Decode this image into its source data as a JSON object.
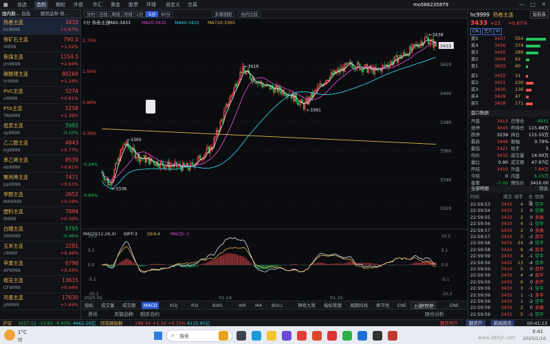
{
  "topbar": {
    "nav": [
      "自选",
      "合约",
      "期权",
      "外盘",
      "外汇",
      "黄金",
      "股票",
      "环球",
      "自定义",
      "交易"
    ],
    "active_index": 1,
    "user": "mo566235879",
    "window_controls": [
      "—",
      "□",
      "✕"
    ]
  },
  "sidebar": {
    "tabs": [
      "国内期...",
      "自选",
      "期货品种",
      "快..."
    ],
    "items": [
      {
        "name": "热卷主连",
        "code": "hc9999",
        "price": "3433",
        "change": "+0.67%",
        "dir": "up"
      },
      {
        "name": "铁矿石主连",
        "code": "i9999",
        "price": "790.0",
        "change": "+1.02%",
        "dir": "up"
      },
      {
        "name": "焦煤主连",
        "code": "jm9999",
        "price": "1154.5",
        "change": "+2.94%",
        "dir": "up"
      },
      {
        "name": "碳酸锂主连",
        "code": "lc9999",
        "price": "80260",
        "change": "+1.24%",
        "dir": "up"
      },
      {
        "name": "PVC主连",
        "code": "v9999",
        "price": "5274",
        "change": "+0.61%",
        "dir": "up"
      },
      {
        "name": "PTA主连",
        "code": "TA9999",
        "price": "5258",
        "change": "+1.39%",
        "dir": "up"
      },
      {
        "name": "纸浆主连",
        "code": "sp9999",
        "price": "5992",
        "change": "-0.10%",
        "dir": "dn"
      },
      {
        "name": "乙二醇主连",
        "code": "eg9999",
        "price": "4843",
        "change": "+0.77%",
        "dir": "up"
      },
      {
        "name": "苯乙烯主连",
        "code": "eb9999",
        "price": "8539",
        "change": "+0.81%",
        "dir": "up"
      },
      {
        "name": "聚丙烯主连",
        "code": "pp9999",
        "price": "7471",
        "change": "+0.51%",
        "dir": "up"
      },
      {
        "name": "甲醇主连",
        "code": "MA9999",
        "price": "2652",
        "change": "+0.19%",
        "dir": "up"
      },
      {
        "name": "塑料主连",
        "code": "l9999",
        "price": "7894",
        "change": "+0.36%",
        "dir": "up"
      },
      {
        "name": "白糖主连",
        "code": "SR9999",
        "price": "5795",
        "change": "-0.46%",
        "dir": "dn"
      },
      {
        "name": "玉米主连",
        "code": "c9999",
        "price": "2281",
        "change": "+0.44%",
        "dir": "up"
      },
      {
        "name": "苹果主连",
        "code": "AP9999",
        "price": "6790",
        "change": "+0.03%",
        "dir": "up"
      },
      {
        "name": "棉花主连",
        "code": "CF9999",
        "price": "13615",
        "change": "+0.44%",
        "dir": "up"
      },
      {
        "name": "鸡蛋主连",
        "code": "jd9999",
        "price": "17630",
        "change": "+1.84%",
        "dir": "up"
      },
      {
        "name": "",
        "code": "ru9999",
        "price": "",
        "change": "",
        "dir": "up"
      }
    ]
  },
  "toolbar": {
    "periods": [
      "分时",
      "日线",
      "周线",
      "月线",
      "1分",
      "5分",
      "60分"
    ],
    "active_period": "5分",
    "extra": [
      "多周期图",
      "合约比较"
    ],
    "title": "5分 热卷主连",
    "ma_labels": [
      "MA5:3433",
      "MA20:3432",
      "MA60:3422",
      "MA720:3365"
    ]
  },
  "chart_data": {
    "type": "candlestick",
    "y_range": [
      3310,
      3445
    ],
    "y_ticks_right": [
      "3433",
      "3420",
      "3400",
      "3380",
      "3360",
      "3340",
      "3320"
    ],
    "y_ticks_left": [
      "2.73%",
      "1.55%",
      "0.96%",
      "0.36%",
      "-0.24%",
      "-0.84%"
    ],
    "annotations": [
      {
        "label": "3438",
        "value": 3438
      },
      {
        "label": "3416",
        "value": 3416
      },
      {
        "label": "3391",
        "value": 3391
      },
      {
        "label": "3365",
        "value": 3365
      },
      {
        "label": "3336",
        "value": 3336
      }
    ],
    "x_labels": [
      "2025-01",
      "01-14",
      "01-15"
    ],
    "macd": {
      "title": "MACD(12,26,9)",
      "diff": "DIFF:3",
      "dea": "DEA:4",
      "macd": "MACD:-1",
      "y_ticks": [
        "10.2",
        "5.1",
        "0.0",
        "-5.1",
        "-10.2"
      ]
    },
    "series_colors": {
      "up": "#ff4d4d",
      "down": "#22c55e",
      "ma5": "#e8eaee",
      "ma20": "#e04fd0",
      "ma60": "#34d5e6",
      "ma720": "#e6b84f"
    }
  },
  "bottom_tabs": [
    "指标",
    "成交量",
    "成交额",
    "MACD",
    "KDJ",
    "RSI",
    "BIAS",
    "WR",
    "MA",
    "BOLL",
    "神奇九转",
    "指标管理",
    "周期均线",
    "季节性",
    "ENE",
    "EXPMA",
    "ENE"
  ],
  "bottom_tabs_active": "MACD",
  "bottom_btn": "右键/双击",
  "subtabs": [
    "资讯",
    "关联品种",
    "相关合约"
  ],
  "subtabs_right": "持仓分析",
  "right": {
    "code": "hc9999",
    "name": "热卷主连",
    "add_btn": "加自选",
    "price": "3433",
    "change": "+23",
    "change_pct": "+0.67%",
    "tags": [
      "CN",
      "主力",
      "VI"
    ],
    "asks": [
      {
        "lbl": "卖5",
        "price": "3437",
        "vol": "554",
        "bar": 0.9
      },
      {
        "lbl": "卖4",
        "price": "3436",
        "vol": "374",
        "bar": 0.65
      },
      {
        "lbl": "卖3",
        "price": "3435",
        "vol": "289",
        "bar": 0.55
      },
      {
        "lbl": "卖2",
        "price": "3434",
        "vol": "62",
        "bar": 0.15
      },
      {
        "lbl": "卖1",
        "price": "3433",
        "vol": "40",
        "bar": 0.1
      }
    ],
    "bids": [
      {
        "lbl": "买1",
        "price": "3432",
        "vol": "31",
        "bar": 0.1
      },
      {
        "lbl": "买2",
        "price": "3431",
        "vol": "230",
        "bar": 0.35
      },
      {
        "lbl": "买3",
        "price": "3430",
        "vol": "136",
        "bar": 0.25
      },
      {
        "lbl": "买4",
        "price": "3429",
        "vol": "47",
        "bar": 0.12
      },
      {
        "lbl": "买5",
        "price": "3428",
        "vol": "171",
        "bar": 0.3
      }
    ],
    "section_title": "盘口数据",
    "stats": [
      [
        "开盘",
        "3413",
        "日增仓",
        "-4031"
      ],
      [
        "涨停",
        "3645",
        "昨持仓",
        "115.88万"
      ],
      [
        "跌停",
        "3239",
        "持仓",
        "115.55万"
      ],
      [
        "最高",
        "3448",
        "振幅",
        "0.79%"
      ],
      [
        "最低",
        "3421",
        "现手",
        "5"
      ],
      [
        "均价",
        "3432",
        "成交量",
        "14.00万"
      ],
      [
        "量比",
        "0.90",
        "成交额",
        "47.97亿"
      ],
      [
        "昨结",
        "3410",
        "外盘",
        "7.84万"
      ],
      [
        "今结",
        "0",
        "内盘",
        "6.15万"
      ],
      [
        "基差",
        "-7.00",
        "预估价",
        "3410.00"
      ]
    ],
    "ticks_title": "全部明细",
    "ticks_right": "筛选",
    "ticks_header": [
      "时间",
      "成交",
      "现手",
      "仓差",
      "性质"
    ],
    "ticks": [
      [
        "22:59:53",
        "3433",
        "4",
        "-2",
        "空平",
        "dn"
      ],
      [
        "22:59:54",
        "3433",
        "1",
        "0",
        "空换",
        "dn"
      ],
      [
        "22:59:55",
        "3432",
        "2",
        "0",
        "多换",
        "up"
      ],
      [
        "22:59:56",
        "3433",
        "4",
        "-1",
        "空平",
        "dn"
      ],
      [
        "22:59:57",
        "3433",
        "2",
        "0",
        "多换",
        "up"
      ],
      [
        "22:59:57",
        "3433",
        "2",
        "-2",
        "双平",
        "up"
      ],
      [
        "22:59:58",
        "3433",
        "24",
        "-8",
        "空平",
        "dn"
      ],
      [
        "22:59:58",
        "3433",
        "9",
        "-6",
        "双平",
        "up"
      ],
      [
        "22:59:59",
        "3433",
        "4",
        "-1",
        "空平",
        "dn"
      ],
      [
        "22:59:59",
        "3432",
        "13",
        "-4",
        "空平",
        "dn"
      ],
      [
        "22:59:59",
        "3433",
        "5",
        "0",
        "双开",
        "up"
      ],
      [
        "22:59:59",
        "3433",
        "4",
        "-4",
        "双平",
        "up"
      ],
      [
        "22:59:59",
        "3433",
        "6",
        "0",
        "多开",
        "up"
      ],
      [
        "22:59:59",
        "3433",
        "3",
        "-1",
        "空平",
        "dn"
      ],
      [
        "22:59:59",
        "3432",
        "1",
        "-1",
        "多平",
        "up"
      ],
      [
        "22:59:59",
        "3433",
        "1",
        "-2",
        "空平",
        "dn"
      ],
      [
        "22:59:59",
        "3433",
        "2",
        "0",
        "多换",
        "up"
      ],
      [
        "22:59:59",
        "3433",
        "5",
        "-1",
        "空平",
        "dn"
      ]
    ]
  },
  "status": {
    "index1_name": "沪深",
    "index1_val": "3227.12",
    "index1_chg": "-13.82",
    "index1_pct": "-0.43%",
    "index1_vol": "4662.16亿",
    "index2_name": "同花顺指数",
    "index2_val": "198.34",
    "index2_chg": "+1.32",
    "index2_pct": "+0.72%",
    "index2_vol": "8115.95亿",
    "right1": "期货开户",
    "right2": "期货户",
    "right3": "新闻资讯",
    "clock": "00:41:13"
  },
  "taskbar": {
    "weather": "1°C",
    "weather_sub": "阴",
    "search": "搜索",
    "time": "0:41",
    "date": "2025/1/16",
    "watermark": "www.365jz.com"
  }
}
